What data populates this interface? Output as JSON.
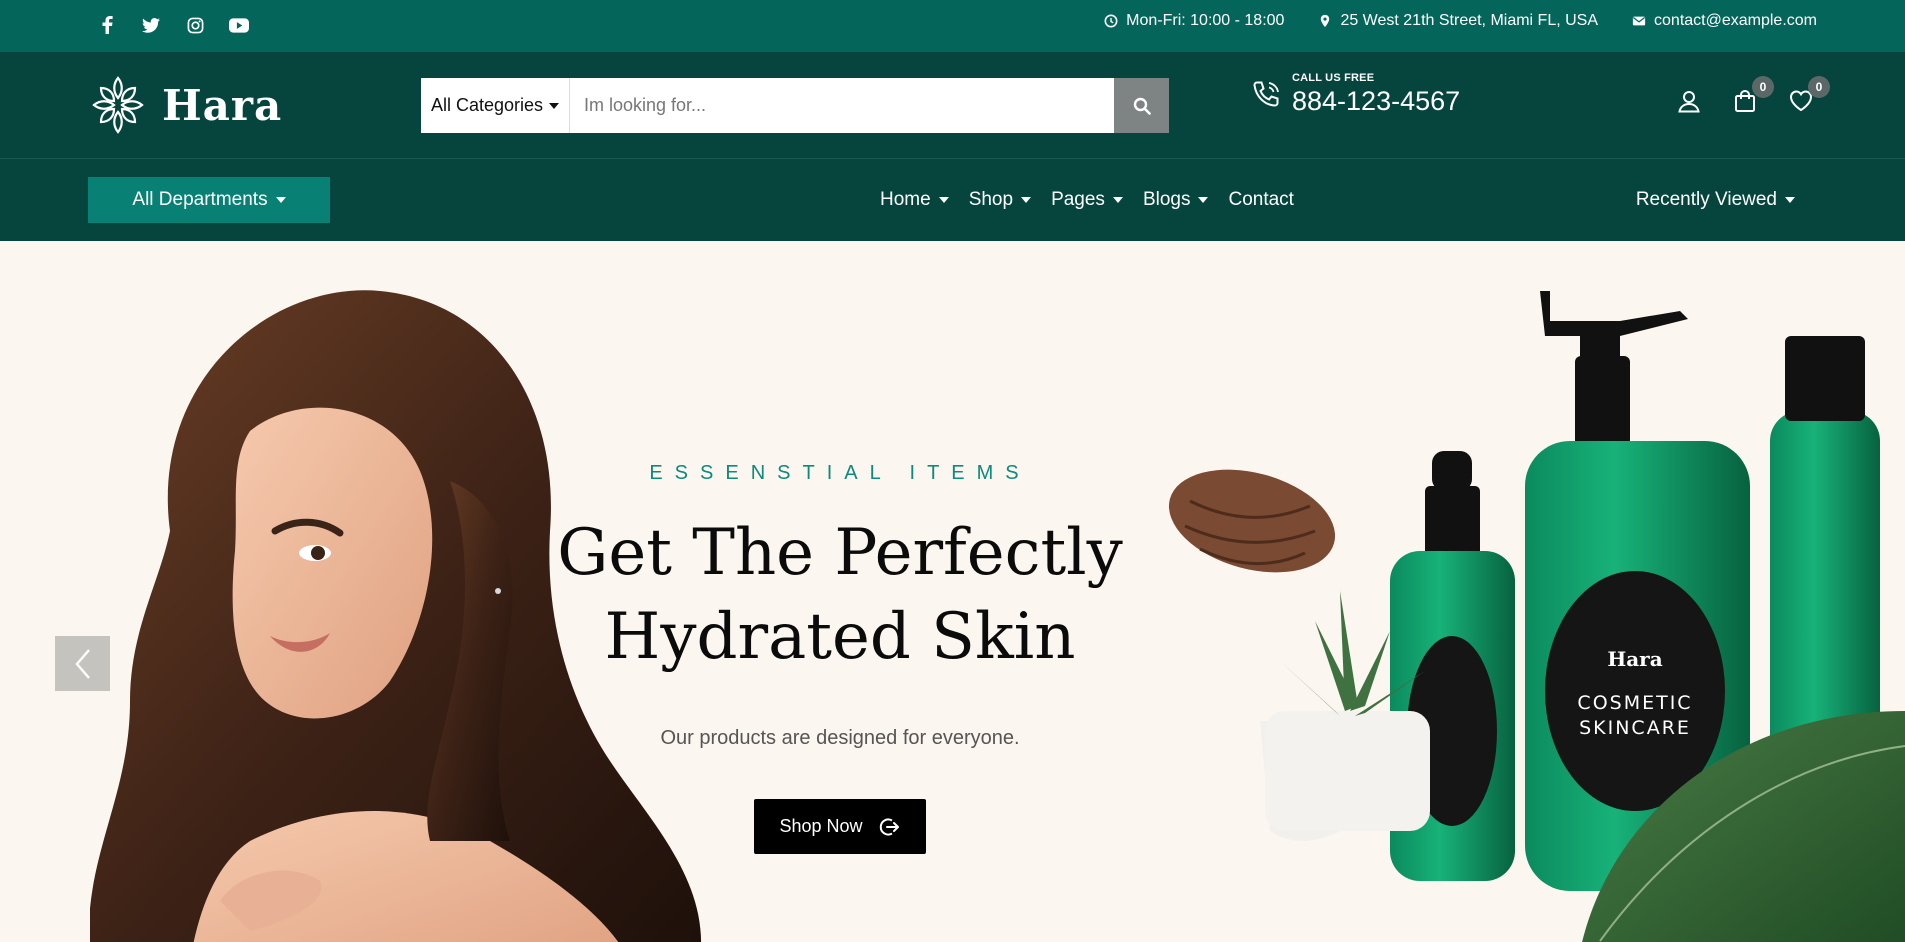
{
  "topbar": {
    "social": [
      "facebook-icon",
      "twitter-icon",
      "instagram-icon",
      "youtube-icon"
    ],
    "hours": "Mon-Fri: 10:00 - 18:00",
    "address": "25 West 21th Street, Miami FL, USA",
    "email": "contact@example.com"
  },
  "header": {
    "logo_text": "Hara",
    "search": {
      "category": "All Categories",
      "placeholder": "Im looking for..."
    },
    "phone": {
      "label": "CALL US FREE",
      "number": "884-123-4567"
    },
    "cart_count": "0",
    "wishlist_count": "0"
  },
  "nav": {
    "departments": "All Departments",
    "items": [
      {
        "label": "Home",
        "dropdown": true
      },
      {
        "label": "Shop",
        "dropdown": true
      },
      {
        "label": "Pages",
        "dropdown": true
      },
      {
        "label": "Blogs",
        "dropdown": true
      },
      {
        "label": "Contact",
        "dropdown": false
      }
    ],
    "recently_viewed": "Recently Viewed"
  },
  "hero": {
    "eyebrow": "ESSENSTIAL ITEMS",
    "headline_line1": "Get The Perfectly",
    "headline_line2": "Hydrated Skin",
    "subtitle": "Our products are designed for everyone.",
    "cta": "Shop Now",
    "bottle_brand": "Hara",
    "bottle_text_1": "COSMETIC",
    "bottle_text_2": "SKINCARE"
  },
  "colors": {
    "topbar": "#04655a",
    "header": "#05453d",
    "accent": "#088174",
    "hero_bg": "#fbf6ef"
  }
}
